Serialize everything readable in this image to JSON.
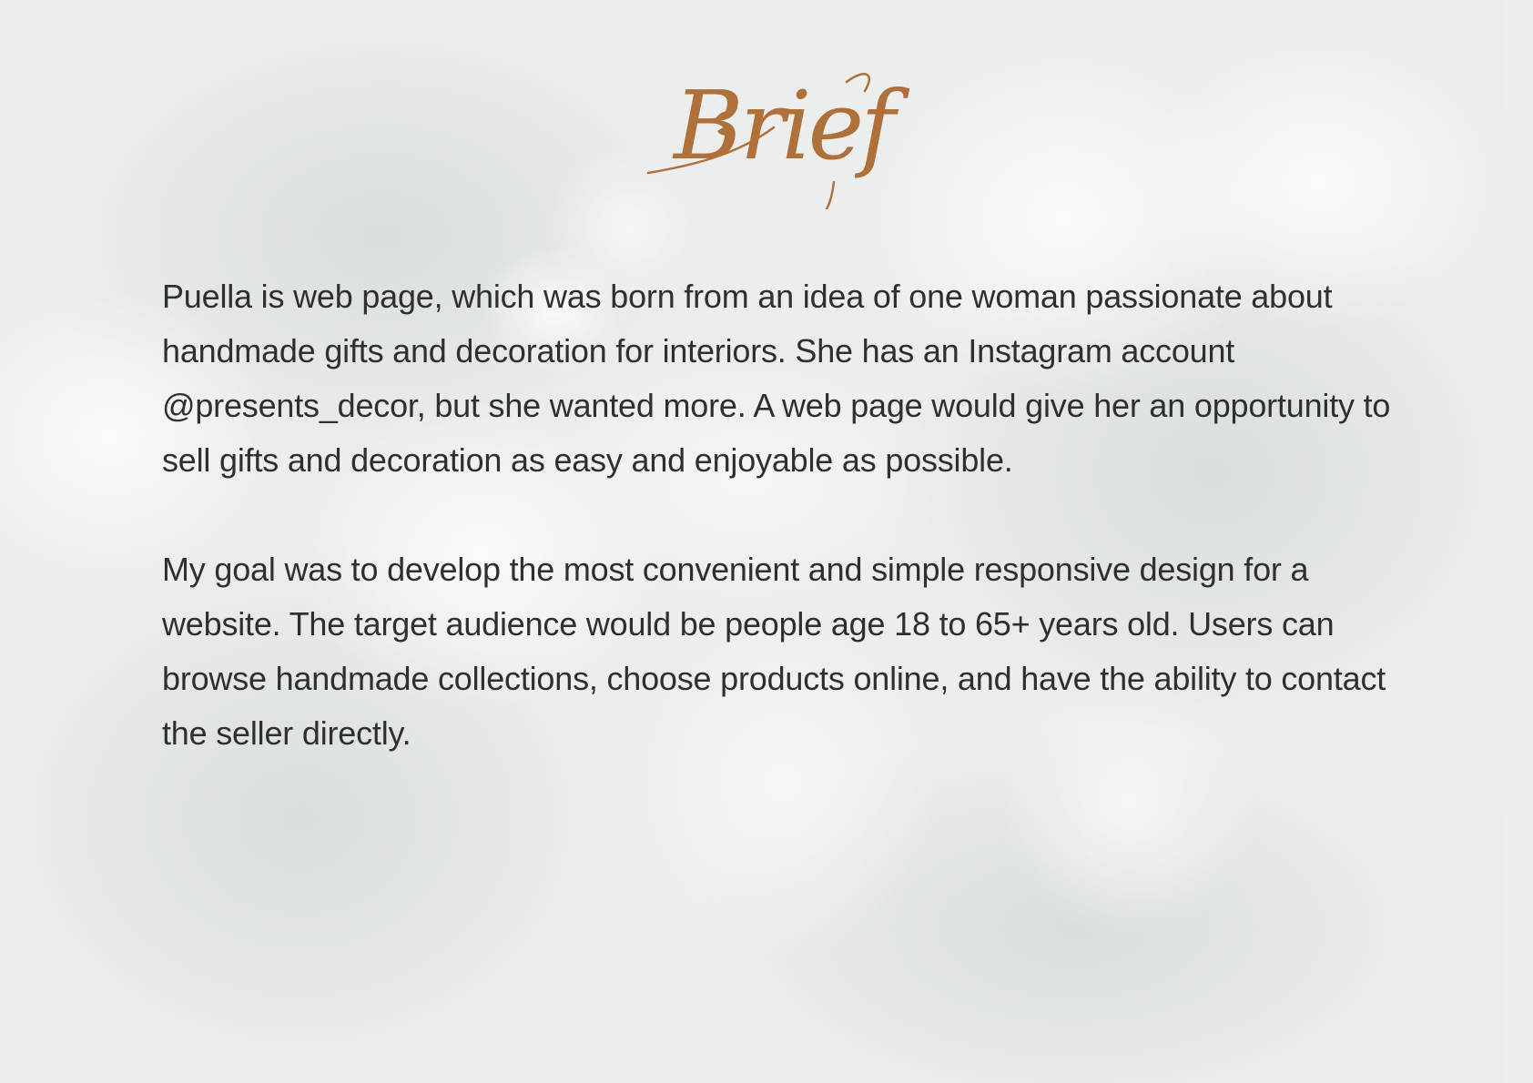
{
  "page": {
    "title": "Brief",
    "paragraphs": [
      "Puella is web page, which was born from an idea of one woman passionate about handmade gifts and decoration for interiors. She has an Instagram account @presents_decor, but she wanted more. A web page would give her an opportunity to sell gifts and decoration as easy and enjoyable as possible.",
      "My goal was to develop the most convenient and simple responsive design for a website. The target audience would be people age 18 to 65+ years old. Users can browse handmade collections, choose products online, and have the ability to contact the seller directly."
    ]
  },
  "colors": {
    "background": "#e9edec",
    "title": "#b0703a",
    "text": "#2f302e"
  },
  "icons": {
    "title_ornament": "leaf-sprig-icon"
  }
}
